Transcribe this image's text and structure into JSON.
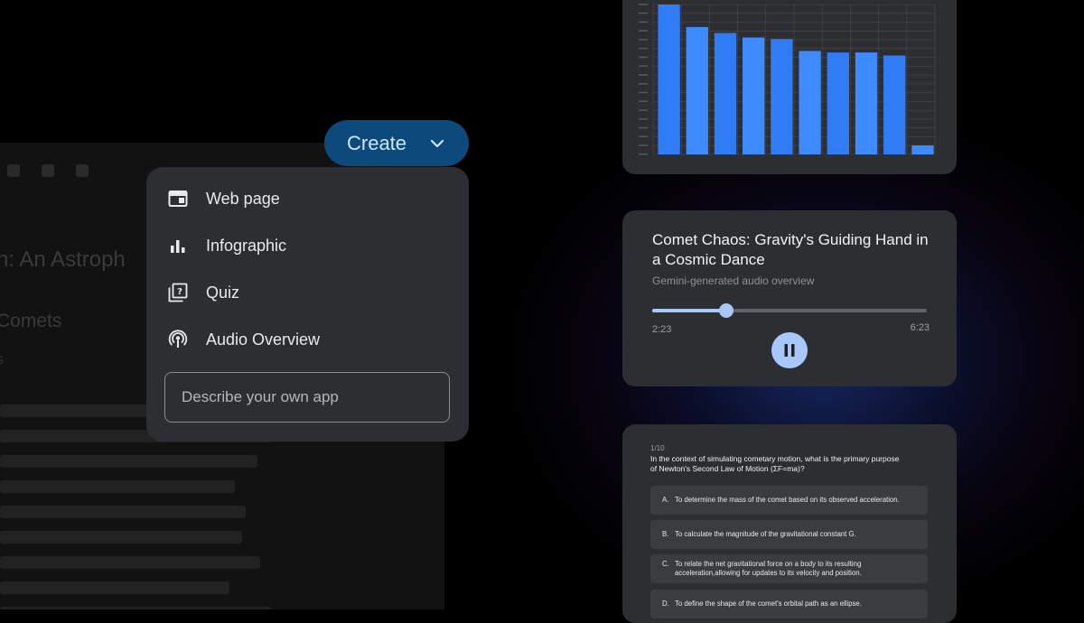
{
  "create_button": {
    "label": "Create",
    "icon": "chevron-down-icon"
  },
  "menu": {
    "items": [
      {
        "label": "Web page",
        "icon": "web-page-icon"
      },
      {
        "label": "Infographic",
        "icon": "bar-chart-icon"
      },
      {
        "label": "Quiz",
        "icon": "quiz-icon"
      },
      {
        "label": "Audio Overview",
        "icon": "podcast-icon"
      }
    ],
    "describe_placeholder": "Describe your own app"
  },
  "background_doc": {
    "title": "n: An Astroph",
    "subheading": "Comets",
    "small": "s"
  },
  "chart_data": {
    "type": "bar",
    "values": [
      100,
      85,
      81,
      78,
      77,
      69,
      68,
      68,
      66,
      6
    ],
    "ylim": [
      0,
      100
    ],
    "grid": true,
    "bar_color": "#2f7cf6",
    "bar_color_alt": "#3e8bff"
  },
  "audio": {
    "title": "Comet Chaos: Gravity's Guiding Hand in a Cosmic Dance",
    "subtitle": "Gemini-generated audio overview",
    "current_time": "2:23",
    "total_time": "6:23",
    "progress": 0.27,
    "pause_icon": "pause-icon"
  },
  "quiz": {
    "counter": "1/10",
    "question": "In the context of simulating cometary motion, what is the primary purpose of Newton's Second Law of Motion (ΣF=ma)?",
    "options": [
      {
        "letter": "A.",
        "text": "To determine the mass of the comet based on its observed acceleration."
      },
      {
        "letter": "B.",
        "text": "To calculate the magnitude of the gravitational constant G."
      },
      {
        "letter": "C.",
        "text": "To relate the net gravitational force on a body to its resulting acceleration,allowing for updates to its velocity and position."
      },
      {
        "letter": "D.",
        "text": "To define the shape of the comet's orbital path as an ellipse."
      }
    ]
  },
  "colors": {
    "accent": "#a8c7fa",
    "create_bg": "#0b4a7a",
    "card_bg": "#2d2e31"
  }
}
